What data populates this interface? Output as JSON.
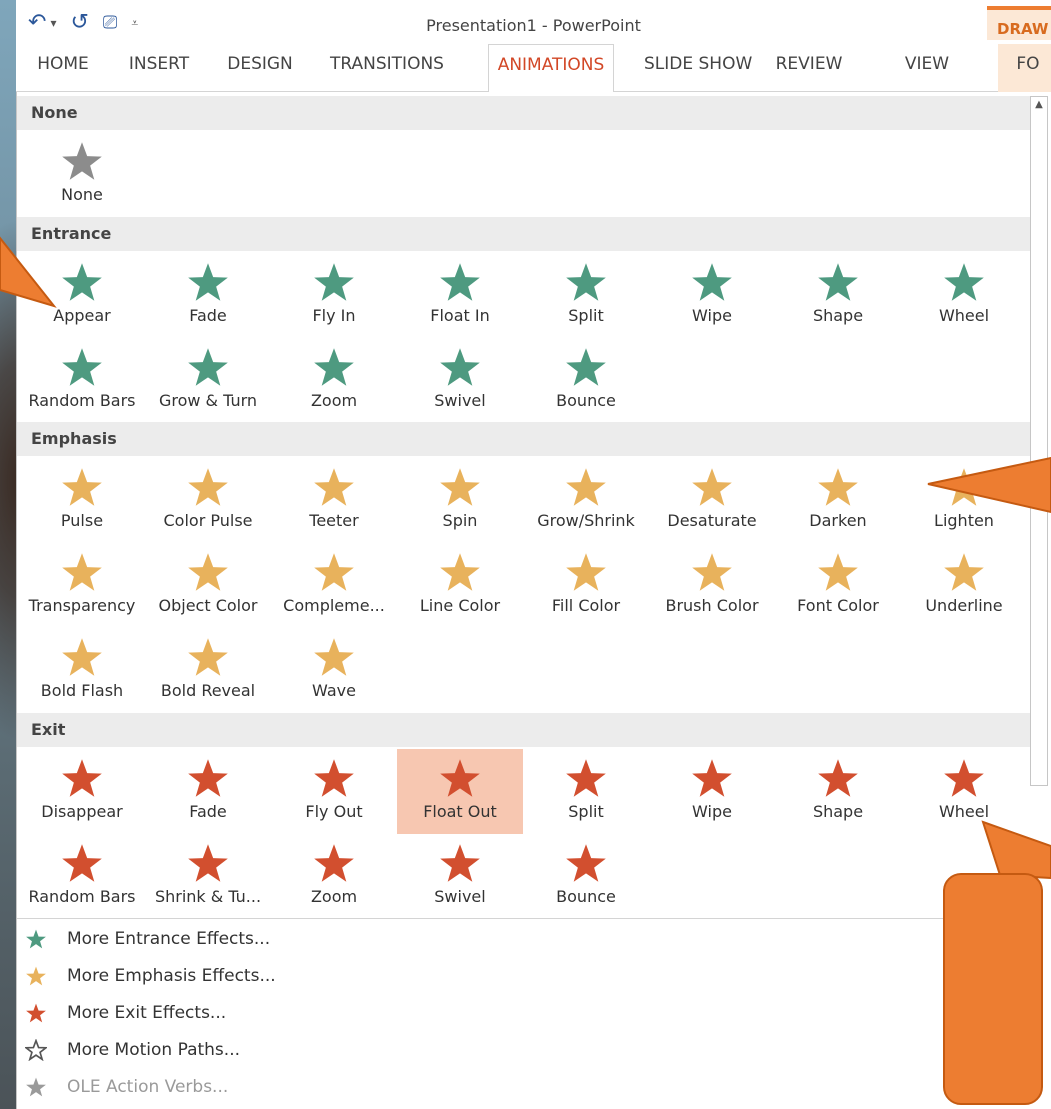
{
  "window": {
    "title": "Presentation1 - PowerPoint",
    "context_tab": "DRAW"
  },
  "ribbon": {
    "tabs": [
      {
        "label": "HOME",
        "active": false
      },
      {
        "label": "INSERT",
        "active": false
      },
      {
        "label": "DESIGN",
        "active": false
      },
      {
        "label": "TRANSITIONS",
        "active": false
      },
      {
        "label": "ANIMATIONS",
        "active": true
      },
      {
        "label": "SLIDE SHOW",
        "active": false
      },
      {
        "label": "REVIEW",
        "active": false
      },
      {
        "label": "VIEW",
        "active": false
      },
      {
        "label": "FO",
        "active": false
      }
    ]
  },
  "gallery": {
    "sections": [
      {
        "name": "None",
        "color": "#8c8c8c",
        "items": [
          "None"
        ]
      },
      {
        "name": "Entrance",
        "color": "#4e9a80",
        "items": [
          "Appear",
          "Fade",
          "Fly In",
          "Float In",
          "Split",
          "Wipe",
          "Shape",
          "Wheel",
          "Random Bars",
          "Grow & Turn",
          "Zoom",
          "Swivel",
          "Bounce"
        ]
      },
      {
        "name": "Emphasis",
        "color": "#e8b25c",
        "items": [
          "Pulse",
          "Color Pulse",
          "Teeter",
          "Spin",
          "Grow/Shrink",
          "Desaturate",
          "Darken",
          "Lighten",
          "Transparency",
          "Object Color",
          "Compleme...",
          "Line Color",
          "Fill Color",
          "Brush Color",
          "Font Color",
          "Underline",
          "Bold Flash",
          "Bold Reveal",
          "Wave"
        ]
      },
      {
        "name": "Exit",
        "color": "#d24f2f",
        "items": [
          "Disappear",
          "Fade",
          "Fly Out",
          "Float Out",
          "Split",
          "Wipe",
          "Shape",
          "Wheel",
          "Random Bars",
          "Shrink & Tu...",
          "Zoom",
          "Swivel",
          "Bounce"
        ]
      }
    ],
    "selected": "Float Out"
  },
  "menu": [
    {
      "label": "More Entrance Effects...",
      "icon": "green-star-icon",
      "color": "#4e9a80",
      "disabled": false
    },
    {
      "label": "More Emphasis Effects...",
      "icon": "yellow-star-icon",
      "color": "#e8b25c",
      "disabled": false
    },
    {
      "label": "More Exit Effects...",
      "icon": "red-star-icon",
      "color": "#d24f2f",
      "disabled": false
    },
    {
      "label": "More Motion Paths...",
      "icon": "outline-star-icon",
      "color": "#555555",
      "disabled": false
    },
    {
      "label": "OLE Action Verbs...",
      "icon": "gears-icon",
      "color": "#9a9a9a",
      "disabled": true
    }
  ],
  "colors": {
    "accent": "#d24726",
    "callout": "#ed7d31",
    "selected_tile": "#f7c7b1"
  }
}
